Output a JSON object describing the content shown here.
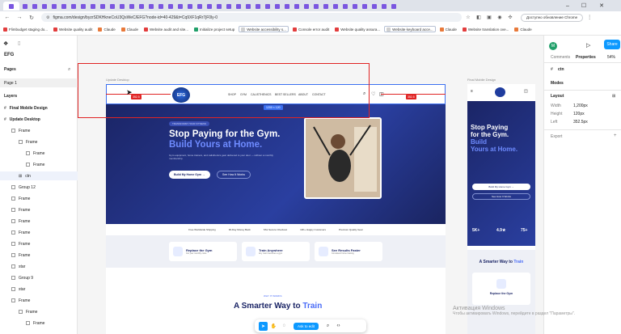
{
  "browser": {
    "url": "figma.com/design/byzrSDKHkneCoU3QsWeC/EFG?node-id=40-429&t=Cq9XF1qRr7jF0ly-0",
    "update_label": "Доступно обновление Chrome"
  },
  "bookmarks": [
    {
      "label": "Flimbudget staging do...",
      "color": "r"
    },
    {
      "label": "Website quality audit",
      "color": "r"
    },
    {
      "label": "Claude",
      "color": "o"
    },
    {
      "label": "Claude",
      "color": "o"
    },
    {
      "label": "Website audit and site...",
      "color": "r"
    },
    {
      "label": "Initialize project setup",
      "color": "g"
    },
    {
      "label": "Website accessibility s...",
      "color": "box"
    },
    {
      "label": "Console error audit",
      "color": "r"
    },
    {
      "label": "Website quality assura...",
      "color": "r"
    },
    {
      "label": "Website keyboard acce...",
      "color": "box"
    },
    {
      "label": "Claude",
      "color": "o"
    },
    {
      "label": "Website translation ove...",
      "color": "r"
    },
    {
      "label": "Claude",
      "color": "o"
    }
  ],
  "figma_left": {
    "file_name": "EFG",
    "pages_label": "Pages",
    "current_page": "Page 1",
    "layers_label": "Layers",
    "layers": [
      {
        "name": "Final Mobile Design",
        "indent": 0,
        "type": "hash"
      },
      {
        "name": "Update Desktop",
        "indent": 0,
        "type": "hash"
      },
      {
        "name": "Frame",
        "indent": 1,
        "type": "frame"
      },
      {
        "name": "Frame",
        "indent": 2,
        "type": "frame"
      },
      {
        "name": "Frame",
        "indent": 3,
        "type": "frame"
      },
      {
        "name": "Frame",
        "indent": 3,
        "type": "frame"
      },
      {
        "name": "ctn",
        "indent": 2,
        "type": "grid",
        "selected": true
      },
      {
        "name": "Group 12",
        "indent": 1,
        "type": "frame"
      },
      {
        "name": "Frame",
        "indent": 1,
        "type": "frame"
      },
      {
        "name": "Frame",
        "indent": 1,
        "type": "frame"
      },
      {
        "name": "Frame",
        "indent": 1,
        "type": "frame"
      },
      {
        "name": "Frame",
        "indent": 1,
        "type": "frame"
      },
      {
        "name": "Frame",
        "indent": 1,
        "type": "frame"
      },
      {
        "name": "Frame",
        "indent": 1,
        "type": "frame"
      },
      {
        "name": "star",
        "indent": 1,
        "type": "frame"
      },
      {
        "name": "Group 9",
        "indent": 1,
        "type": "frame"
      },
      {
        "name": "star",
        "indent": 1,
        "type": "frame"
      },
      {
        "name": "Frame",
        "indent": 1,
        "type": "frame"
      },
      {
        "name": "Frame",
        "indent": 2,
        "type": "frame"
      },
      {
        "name": "Frame",
        "indent": 3,
        "type": "frame"
      }
    ]
  },
  "canvas": {
    "desktop_label": "Update Desktop",
    "mobile_label": "Final Mobile Design",
    "size_badge": "1200 × 120",
    "spacing_left": "352.5",
    "spacing_right": "352.5",
    "nav_items": [
      "SHOP",
      "GYM",
      "CALISTHENICS",
      "BEST SELLERS",
      "ABOUT",
      "CONTACT"
    ],
    "hero_tag": "TRANSFORM YOUR FITNESS",
    "hero_line1": "Stop Paying for the Gym.",
    "hero_line2": "Build Yours at Home.",
    "hero_desc": "Gym equipment, home trainers, and calisthenics gear delivered to your door — without a monthly membership.",
    "cta_primary": "Build My Home Gym →",
    "cta_secondary": "See How It Works",
    "features": [
      "Free Worldwide Shipping",
      "30-Day Money Back",
      "SSL Secure Checkout",
      "10K+ Happy Customers",
      "Premium Quality Gear"
    ],
    "cards": [
      {
        "title": "Replace the Gym",
        "sub": "Cut your monthly costs"
      },
      {
        "title": "Train Anywhere",
        "sub": "Any room becomes a gym"
      },
      {
        "title": "See Results Faster",
        "sub": "Consistent home training"
      }
    ],
    "section_kicker": "WHY IT WORKS",
    "section_title": "A Smarter Way to",
    "section_title_acc": "Train",
    "mobile_h1a": "Stop Paying",
    "mobile_h1b": "for the Gym.",
    "mobile_h1c": "Build",
    "mobile_h1d": "Yours at Home.",
    "mobile_cta1": "Build My Home Gym →",
    "mobile_cta2": "See How It Works",
    "mobile_stats": [
      "5K+",
      "4.9★",
      "75+"
    ],
    "mobile_section": "A Smarter Way to",
    "mobile_section_acc": "Train",
    "mobile_card": "Replace the Gym"
  },
  "figma_right": {
    "avatar": "M",
    "share_label": "Share",
    "tab_comments": "Comments",
    "tab_properties": "Properties",
    "zoom": "54%",
    "selected_layer": "ctn",
    "modes_label": "Modes",
    "layout_label": "Layout",
    "width_label": "Width",
    "width_value": "1,200px",
    "height_label": "Height",
    "height_value": "120px",
    "left_label": "Left",
    "left_value": "352.5px",
    "export_label": "Export"
  },
  "toolbar": {
    "dev_mode_label": "Ask to edit"
  },
  "windows": {
    "activate_title": "Активация Windows",
    "activate_sub": "Чтобы активировать Windows, перейдите в раздел \"Параметры\"."
  },
  "colors": {
    "figma_blue": "#0d99ff",
    "hero_navy": "#1b2566",
    "accent": "#4a6cf7",
    "annotation_red": "#e02424"
  }
}
